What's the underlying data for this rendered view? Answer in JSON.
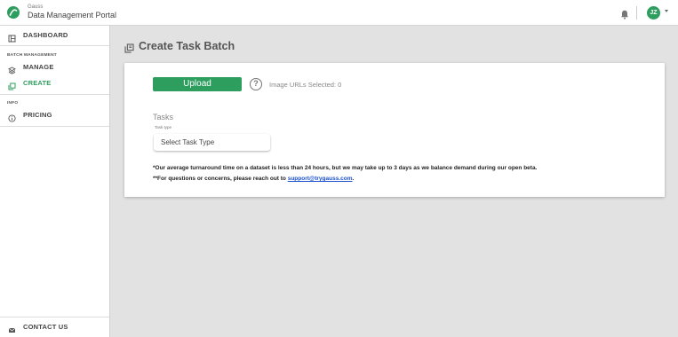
{
  "header": {
    "brand_small": "Gauss",
    "brand_title": "Data Management Portal",
    "user_initials": "JZ"
  },
  "sidebar": {
    "dashboard": "DASHBOARD",
    "section_batch": "BATCH MANAGEMENT",
    "manage": "MANAGE",
    "create": "CREATE",
    "section_info": "INFO",
    "pricing": "PRICING",
    "contact": "CONTACT US"
  },
  "main": {
    "title": "Create Task Batch",
    "upload_label": "Upload",
    "help_glyph": "?",
    "image_urls_selected": "Image URLs Selected: 0",
    "tasks_heading": "Tasks",
    "task_type_label": "Task type",
    "task_type_placeholder": "Select Task Type",
    "note1": "*Our average turnaround time on a dataset is less than 24 hours, but we may take up to 3 days as we balance demand during our open beta.",
    "note2_prefix": "**For questions or concerns, please reach out to ",
    "note2_email": "support@trygauss.com",
    "note2_suffix": "."
  },
  "colors": {
    "accent": "#2e9e5f",
    "link": "#1a4fd0",
    "background": "#e2e2e2"
  },
  "icons": {
    "logo": "gauss-logo-icon",
    "bell": "bell-icon",
    "dashboard": "dashboard-icon",
    "manage": "layers-icon",
    "create": "copy-icon",
    "pricing": "info-circle-icon",
    "contact": "mail-icon",
    "help": "question-circle-icon"
  }
}
